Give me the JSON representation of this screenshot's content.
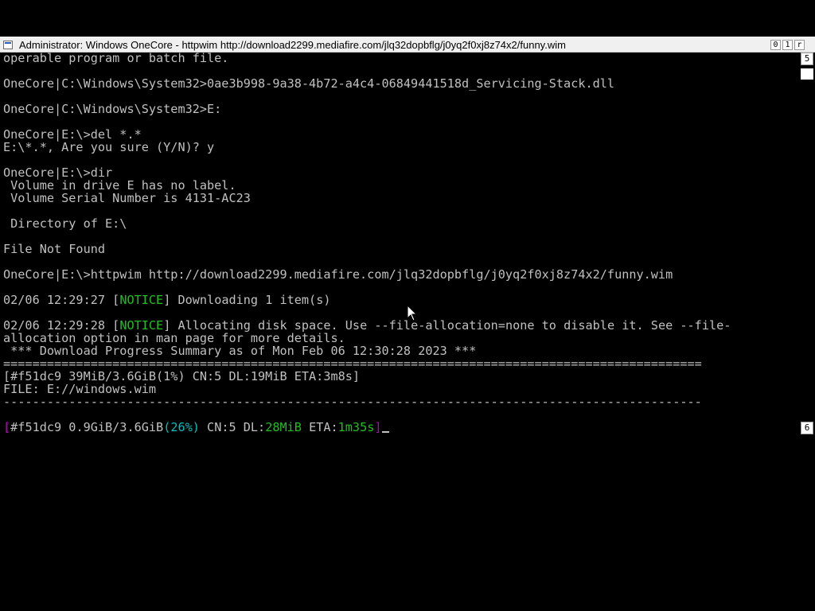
{
  "window": {
    "title": "Administrator:  Windows OneCore - httpwim  http://download2299.mediafire.com/jlq32dopbflg/j0yq2f0xj8z74x2/funny.wim",
    "buttons": {
      "minimize": "0",
      "maximize": "1",
      "close": "r"
    }
  },
  "scrollbar": {
    "up": "5",
    "down": "6"
  },
  "console": {
    "lines": {
      "l01": "operable program or batch file.",
      "l03": "OneCore|C:\\Windows\\System32>0ae3b998-9a38-4b72-a4c4-06849441518d_Servicing-Stack.dll",
      "l05": "OneCore|C:\\Windows\\System32>E:",
      "l07": "OneCore|E:\\>del *.*",
      "l08": "E:\\*.*, Are you sure (Y/N)? y",
      "l10": "OneCore|E:\\>dir",
      "l11": " Volume in drive E has no label.",
      "l12": " Volume Serial Number is 4131-AC23",
      "l14": " Directory of E:\\",
      "l16": "File Not Found",
      "l18": "OneCore|E:\\>httpwim http://download2299.mediafire.com/jlq32dopbflg/j0yq2f0xj8z74x2/funny.wim",
      "l20_time": "02/06 12:29:27 [",
      "l20_tag": "NOTICE",
      "l20_msg": "] Downloading 1 item(s)",
      "l22_time": "02/06 12:29:28 [",
      "l22_tag": "NOTICE",
      "l22_msg": "] Allocating disk space. Use --file-allocation=none to disable it. See --file-",
      "l23": "allocation option in man page for more details.",
      "l24": " *** Download Progress Summary as of Mon Feb 06 12:30:28 2023 ***",
      "l25": "================================================================================================",
      "l26": "[#f51dc9 39MiB/3.6GiB(1%) CN:5 DL:19MiB ETA:3m8s]",
      "l27": "FILE: E://windows.wim",
      "l28": "------------------------------------------------------------------------------------------------",
      "l30_open": "[",
      "l30_id": "#f51dc9 0.9GiB/3.6GiB",
      "l30_pct": "(26%)",
      "l30_cn": " CN:5 DL:",
      "l30_dl": "28MiB",
      "l30_eta_label": " ETA:",
      "l30_eta": "1m35s",
      "l30_close": "]"
    },
    "colors": {
      "text": "#c0c0c0",
      "notice": "#1ec01e",
      "bracket": "#c000c0",
      "percent": "#00c0c0"
    }
  }
}
